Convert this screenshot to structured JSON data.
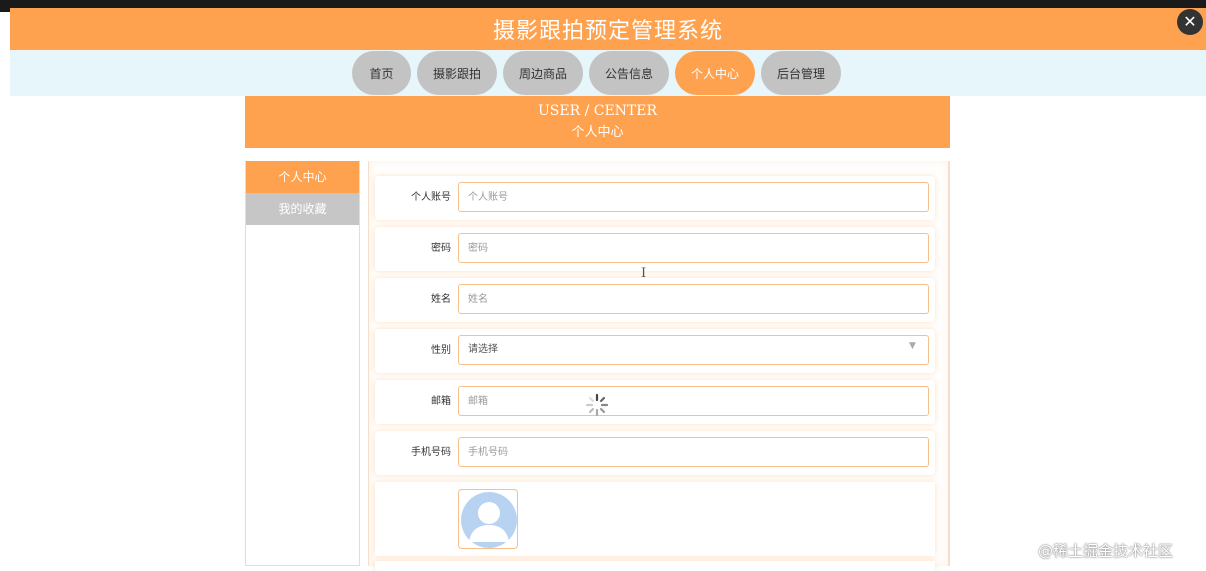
{
  "header": {
    "title": "摄影跟拍预定管理系统",
    "close_glyph": "✕"
  },
  "nav": {
    "tabs": [
      {
        "label": "首页"
      },
      {
        "label": "摄影跟拍"
      },
      {
        "label": "周边商品"
      },
      {
        "label": "公告信息"
      },
      {
        "label": "个人中心",
        "active": true
      },
      {
        "label": "后台管理"
      }
    ]
  },
  "banner": {
    "en": "USER / CENTER",
    "cn": "个人中心"
  },
  "sidebar": {
    "items": [
      {
        "label": "个人中心",
        "active": true
      },
      {
        "label": "我的收藏"
      }
    ]
  },
  "form": {
    "account": {
      "label": "个人账号",
      "placeholder": "个人账号"
    },
    "password": {
      "label": "密码",
      "placeholder": "密码"
    },
    "name": {
      "label": "姓名",
      "placeholder": "姓名"
    },
    "gender": {
      "label": "性别",
      "value": "请选择"
    },
    "email": {
      "label": "邮箱",
      "placeholder": "邮箱"
    },
    "phone": {
      "label": "手机号码",
      "placeholder": "手机号码"
    }
  },
  "cursor_glyph": "I",
  "watermark": "@稀土掘金技术社区",
  "colors": {
    "accent": "#ffa24f",
    "tab_inactive": "#c3c3c3",
    "nav_bg": "#e6f6fb"
  },
  "icons": {
    "avatar": "user-avatar-icon",
    "loading": "spinner-icon"
  }
}
